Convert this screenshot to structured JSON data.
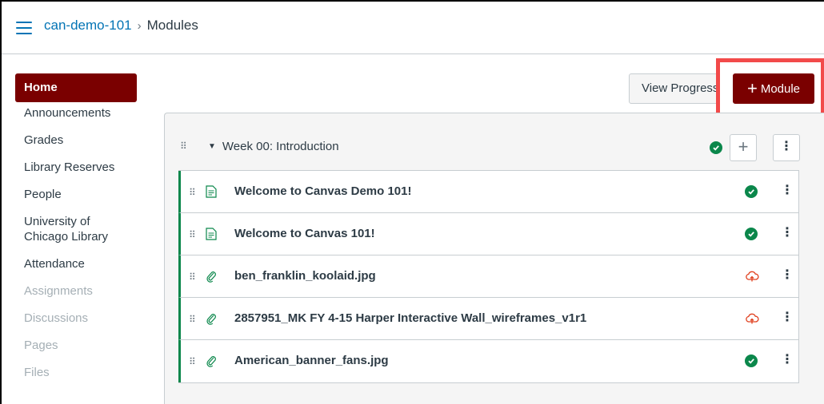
{
  "header": {
    "course_link": "can-demo-101",
    "separator": "›",
    "current_page": "Modules"
  },
  "nav": {
    "home": "Home",
    "items": [
      {
        "label": "Announcements",
        "enabled": true
      },
      {
        "label": "Grades",
        "enabled": true
      },
      {
        "label": "Library Reserves",
        "enabled": true
      },
      {
        "label": "People",
        "enabled": true
      },
      {
        "label": "University of Chicago Library",
        "enabled": true
      },
      {
        "label": "Attendance",
        "enabled": true
      },
      {
        "label": "Assignments",
        "enabled": false
      },
      {
        "label": "Discussions",
        "enabled": false
      },
      {
        "label": "Pages",
        "enabled": false
      },
      {
        "label": "Files",
        "enabled": false
      }
    ]
  },
  "toolbar": {
    "view_progress_label": "View Progress",
    "module_button_plus": "+",
    "module_button_label": "Module"
  },
  "module": {
    "title": "Week 00: Introduction",
    "add_symbol": "+",
    "menu_symbol": "⋮",
    "items": [
      {
        "title": "Welcome to Canvas Demo 101!",
        "icon": "page-icon",
        "status": "published-check-icon"
      },
      {
        "title": "Welcome to Canvas 101!",
        "icon": "page-icon",
        "status": "published-check-icon"
      },
      {
        "title": "ben_franklin_koolaid.jpg",
        "icon": "attachment-icon",
        "status": "unpublished-cloud-icon"
      },
      {
        "title": "2857951_MK FY 4-15 Harper Interactive Wall_wireframes_v1r1",
        "icon": "attachment-icon",
        "status": "unpublished-cloud-icon"
      },
      {
        "title": "American_banner_fans.jpg",
        "icon": "attachment-icon",
        "status": "published-check-icon"
      }
    ]
  },
  "colors": {
    "brand": "#7a0000",
    "link": "#0374b5",
    "success": "#0b874b",
    "unpublished": "#e0401f",
    "highlight": "#f24a4a"
  }
}
